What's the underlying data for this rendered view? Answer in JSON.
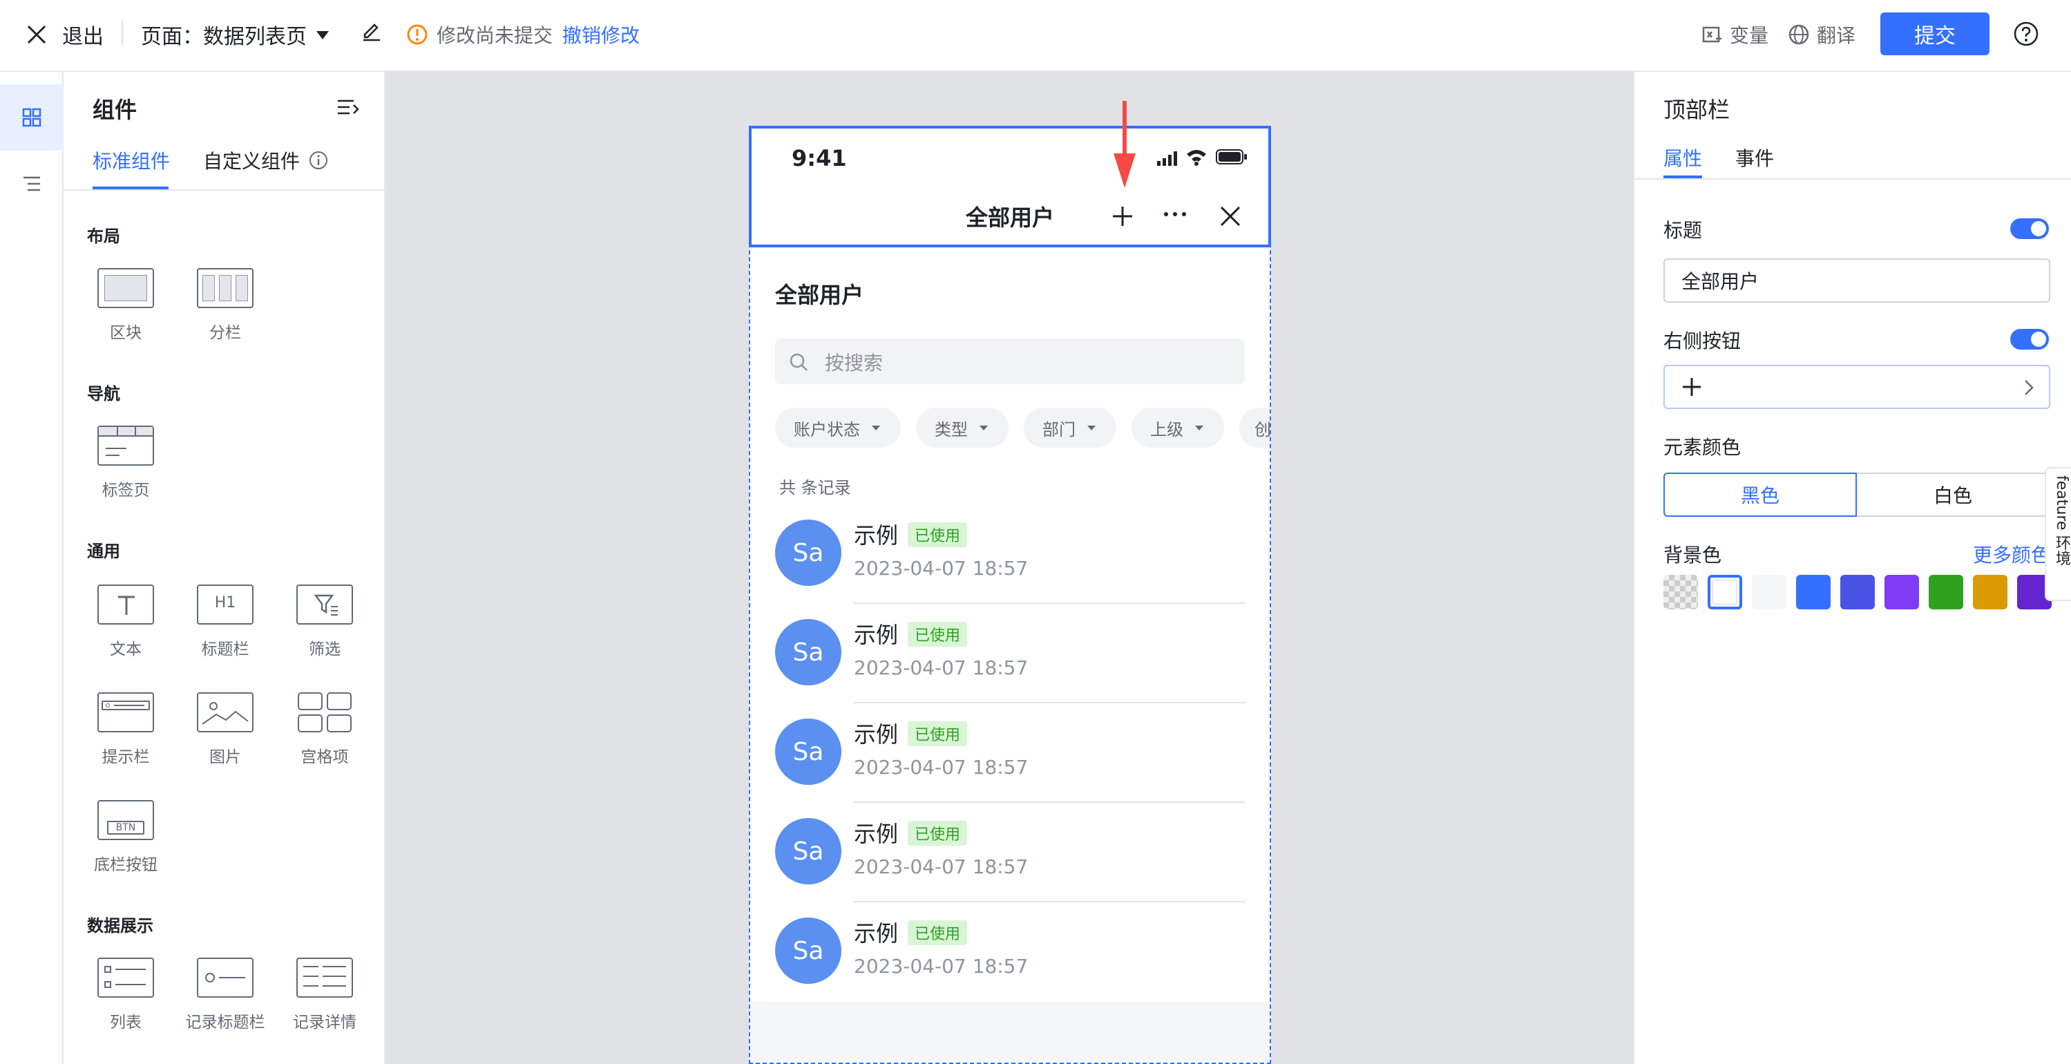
{
  "topbar": {
    "exit_label": "退出",
    "page_prefix": "页面：",
    "page_name": "数据列表页",
    "unsaved_text": "修改尚未提交",
    "undo_label": "撤销修改",
    "variables_label": "变量",
    "translate_label": "翻译",
    "submit_label": "提交"
  },
  "components": {
    "title": "组件",
    "tabs": [
      "标准组件",
      "自定义组件"
    ],
    "sections": {
      "layout": {
        "title": "布局",
        "items": [
          "区块",
          "分栏"
        ]
      },
      "nav": {
        "title": "导航",
        "items": [
          "标签页"
        ]
      },
      "general": {
        "title": "通用",
        "items": [
          "文本",
          "标题栏",
          "筛选",
          "提示栏",
          "图片",
          "宫格项",
          "底栏按钮"
        ]
      },
      "display": {
        "title": "数据展示",
        "items": [
          "列表",
          "记录标题栏",
          "记录详情"
        ]
      }
    },
    "icon_text": {
      "heading": "H1",
      "button": "BTN"
    }
  },
  "phone": {
    "time": "9:41",
    "nav_title": "全部用户",
    "page_title": "全部用户",
    "search_placeholder": "按搜索",
    "filters": [
      "账户状态",
      "类型",
      "部门",
      "上级",
      "创"
    ],
    "record_count": "共 条记录",
    "rows": [
      {
        "avatar": "Sa",
        "name": "示例",
        "badge": "已使用",
        "time": "2023-04-07 18:57"
      },
      {
        "avatar": "Sa",
        "name": "示例",
        "badge": "已使用",
        "time": "2023-04-07 18:57"
      },
      {
        "avatar": "Sa",
        "name": "示例",
        "badge": "已使用",
        "time": "2023-04-07 18:57"
      },
      {
        "avatar": "Sa",
        "name": "示例",
        "badge": "已使用",
        "time": "2023-04-07 18:57"
      },
      {
        "avatar": "Sa",
        "name": "示例",
        "badge": "已使用",
        "time": "2023-04-07 18:57"
      }
    ]
  },
  "props": {
    "title": "顶部栏",
    "tabs": [
      "属性",
      "事件"
    ],
    "title_label": "标题",
    "title_value": "全部用户",
    "right_btn_label": "右侧按钮",
    "element_color_label": "元素颜色",
    "color_options": [
      "黑色",
      "白色"
    ],
    "bg_color_label": "背景色",
    "more_colors": "更多颜色",
    "swatches": [
      "#ffffff",
      "#f5f6f7",
      "#3370ff",
      "#4954e6",
      "#7f3bf5",
      "#2ea121",
      "#dc9b04",
      "#6425d0"
    ],
    "feature_tab": "feature 环境"
  },
  "colors": {
    "accent": "#3370ff",
    "warning": "#ff8800",
    "success": "#2ea121",
    "arrow": "#f54a45"
  }
}
